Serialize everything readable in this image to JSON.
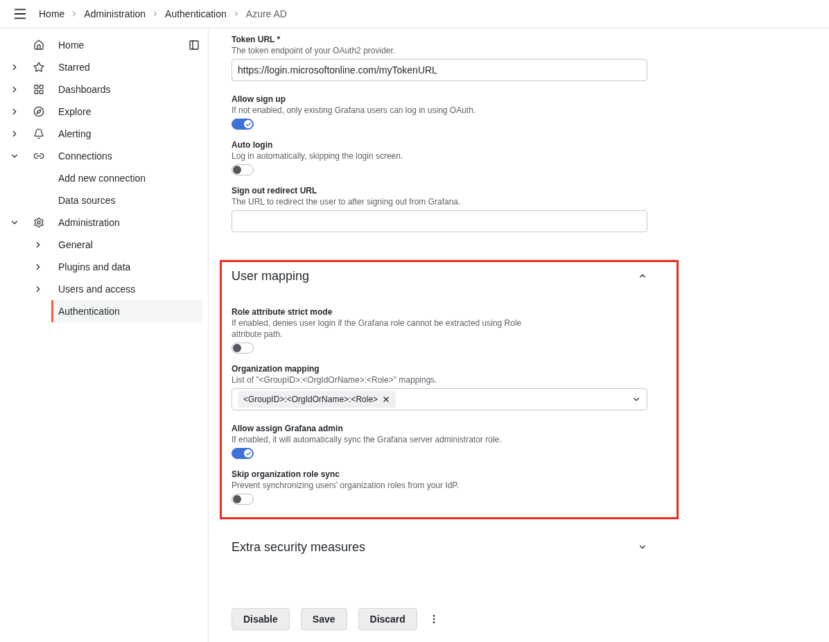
{
  "breadcrumbs": [
    {
      "label": "Home",
      "current": false
    },
    {
      "label": "Administration",
      "current": false
    },
    {
      "label": "Authentication",
      "current": false
    },
    {
      "label": "Azure AD",
      "current": true
    }
  ],
  "sidebar": {
    "items": [
      {
        "label": "Home",
        "selected": false
      },
      {
        "label": "Starred",
        "selected": false,
        "expanded": false
      },
      {
        "label": "Dashboards",
        "selected": false,
        "expanded": false
      },
      {
        "label": "Explore",
        "selected": false,
        "expanded": false
      },
      {
        "label": "Alerting",
        "selected": false,
        "expanded": false
      },
      {
        "label": "Connections",
        "selected": false,
        "expanded": true,
        "children": [
          {
            "label": "Add new connection",
            "selected": false
          },
          {
            "label": "Data sources",
            "selected": false
          }
        ]
      },
      {
        "label": "Administration",
        "selected": false,
        "expanded": true,
        "children": [
          {
            "label": "General",
            "selected": false,
            "expanded": false
          },
          {
            "label": "Plugins and data",
            "selected": false,
            "expanded": false
          },
          {
            "label": "Users and access",
            "selected": false,
            "expanded": false
          },
          {
            "label": "Authentication",
            "selected": true
          }
        ]
      }
    ]
  },
  "sections": [
    {
      "fields": [
        {
          "kind": "text",
          "label": "Token URL *",
          "description": "The token endpoint of your OAuth2 provider.",
          "value": "https://login.microsoftonline.com/myTokenURL"
        },
        {
          "kind": "toggle",
          "label": "Allow sign up",
          "description": "If not enabled, only existing Grafana users can log in using OAuth.",
          "on": true
        },
        {
          "kind": "toggle",
          "label": "Auto login",
          "description": "Log in automatically, skipping the login screen.",
          "on": false
        },
        {
          "kind": "text",
          "label": "Sign out redirect URL",
          "description": "The URL to redirect the user to after signing out from Grafana."
        }
      ]
    },
    {
      "title": "User mapping",
      "expanded": true,
      "highlighted": true,
      "fields": [
        {
          "kind": "toggle",
          "label": "Role attribute strict mode",
          "description": "If enabled, denies user login if the Grafana role cannot be extracted using Role attribute path.",
          "on": false
        },
        {
          "kind": "multiselect",
          "label": "Organization mapping",
          "description": "List of \"<GroupID>:<OrgIdOrName>:<Role>\" mappings.",
          "tags": [
            "<GroupID>:<OrgIdOrName>:<Role>"
          ]
        },
        {
          "kind": "toggle",
          "label": "Allow assign Grafana admin",
          "description": "If enabled, it will automatically sync the Grafana server administrator role.",
          "on": true
        },
        {
          "kind": "toggle",
          "label": "Skip organization role sync",
          "description": "Prevent synchronizing users’ organization roles from your IdP.",
          "on": false
        }
      ]
    },
    {
      "title": "Extra security measures",
      "expanded": false,
      "highlighted": false
    }
  ],
  "buttons": [
    "Disable",
    "Save",
    "Discard"
  ]
}
